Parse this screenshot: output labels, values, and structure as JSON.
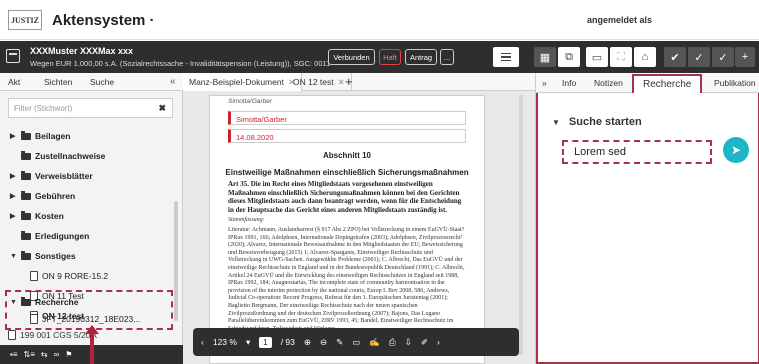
{
  "app": {
    "logo_text": "JUSTIZ",
    "title": "Aktensystem ·",
    "user_label": "angemeldet als"
  },
  "case": {
    "title": "XXXMuster XXXMax xxx",
    "subtitle": "Wegen EUR 1.000,00 s.A. (Sozialrechtssache - Invaliditätspension (Leistung)), SGC: 0011",
    "buttons": [
      "Verbunden",
      "Haft",
      "Antrag",
      "..."
    ]
  },
  "toolbar_icons": [
    "grid-icon",
    "copy-icon",
    "window-icon",
    "expand-icon",
    "home-icon",
    "check-icon",
    "check-double-icon",
    "check-plus-icon"
  ],
  "left": {
    "tabs": [
      "Akt",
      "Sichten",
      "Suche"
    ],
    "filter_placeholder": "Filter (Stichwort)",
    "tree": [
      {
        "label": "Beilagen",
        "level": 0,
        "caret": "▶",
        "type": "folder"
      },
      {
        "label": "Zustellnachweise",
        "level": 0,
        "caret": "",
        "type": "folder"
      },
      {
        "label": "Verweisblätter",
        "level": 0,
        "caret": "▶",
        "type": "folder"
      },
      {
        "label": "Gebühren",
        "level": 0,
        "caret": "▶",
        "type": "folder"
      },
      {
        "label": "Kosten",
        "level": 0,
        "caret": "▶",
        "type": "folder"
      },
      {
        "label": "Erledigungen",
        "level": 0,
        "caret": "",
        "type": "folder"
      },
      {
        "label": "Sonstiges",
        "level": 0,
        "caret": "▼",
        "type": "folder"
      },
      {
        "label": "ON 9 RORE-15.2",
        "level": 1,
        "caret": "",
        "type": "doc"
      },
      {
        "label": "ON 11 Test",
        "level": 1,
        "caret": "",
        "type": "doc"
      },
      {
        "label": "ON 12 test",
        "level": 1,
        "caret": "",
        "type": "doc"
      },
      {
        "label": "Recherche",
        "level": 0,
        "caret": "▼",
        "type": "folder"
      },
      {
        "label": "JFT_20190312_18E023...",
        "level": 1,
        "caret": "",
        "type": "doc"
      }
    ],
    "bottom_item": "199 001 CGS 5/20 k"
  },
  "doc": {
    "tabs": [
      "Manz-Beispiel-Dokument",
      "ON 12 test"
    ],
    "meta": "Simotta/Garber",
    "field1": "Simotta/Garber",
    "field2": "14.08.2020",
    "abschnitt": "Abschnitt 10",
    "heading": "Einstweilige Maßnahmen einschließlich Sicherungsmaßnahmen",
    "article": "Art 35. Die im Recht eines Mitgliedstaats vorgesehenen einstweiligen Maßnahmen einschließlich Sicherungsmaßnahmen können bei den Gerichten dieses Mitgliedstaats auch dann beantragt werden, wenn für die Entscheidung in der Hauptsache das Gericht eines anderen Mitgliedstaats zuständig ist.",
    "stamm": "Stammfassung:",
    "literature": "Literatur: Achmann, Auslandsarrest (§ 917 Abs 2 ZPO) bei Vollstreckung in einem EuGVÜ-Staat? IPRax 1991, 166; Adolphsen, Internationale Dopingstrafen (2003); Adolphsen, Zivilprozessrecht² (2020); Alvarez, Internationale Beweisaufnahme in den Mitgliedstaaten der EU; Beweissicherung und Beweisvorbeugung (2015) 1; Alvarez-Sparganis, Einstweiliger Rechtsschutz und Vollstreckung in UWG-Sachen. Ausgewählte Probleme (2001); C. Albrecht, Das EuGVÜ und der einstweilige Rechtsschutz in England und in der Bundesrepublik Deutschland (1991); C. Albrecht, Artikel 24 EuGVÜ und die Entwicklung des einstweiligen Rechtsschutzes in England seit 1988, IPRax 1992, 184; Anagnostarias, The incomplete state of community harmonisation in the provision of the interim protection by the national courts, Europ L Rev 2008, 586; Andrews, Judicial Co-operation: Recent Progress, Referat für den 1. Europäischen Juristentag (2001); Baglietto Bergmann, Der einstweilige Rechtsschutz nach der neuen spanischen Zivilprozeßordnung und der deutschen Zivilprozeßordnung (2007); Bajons, Das Lugano Parallelübereinkommen zum EuGVÜ, ZfRV 1993, 45; Bandel, Einstweiliger Rechtsschutz im Schiedsverfahren. Zulässigkeit und Wirkung",
    "zoom": "123 %",
    "page_current": "1",
    "page_total": "/ 93"
  },
  "right": {
    "tabs": [
      "Info",
      "Notizen",
      "Recherche",
      "Publikation"
    ],
    "active_tab": "Recherche",
    "section_title": "Suche starten",
    "search_value": "Lorem sed"
  }
}
